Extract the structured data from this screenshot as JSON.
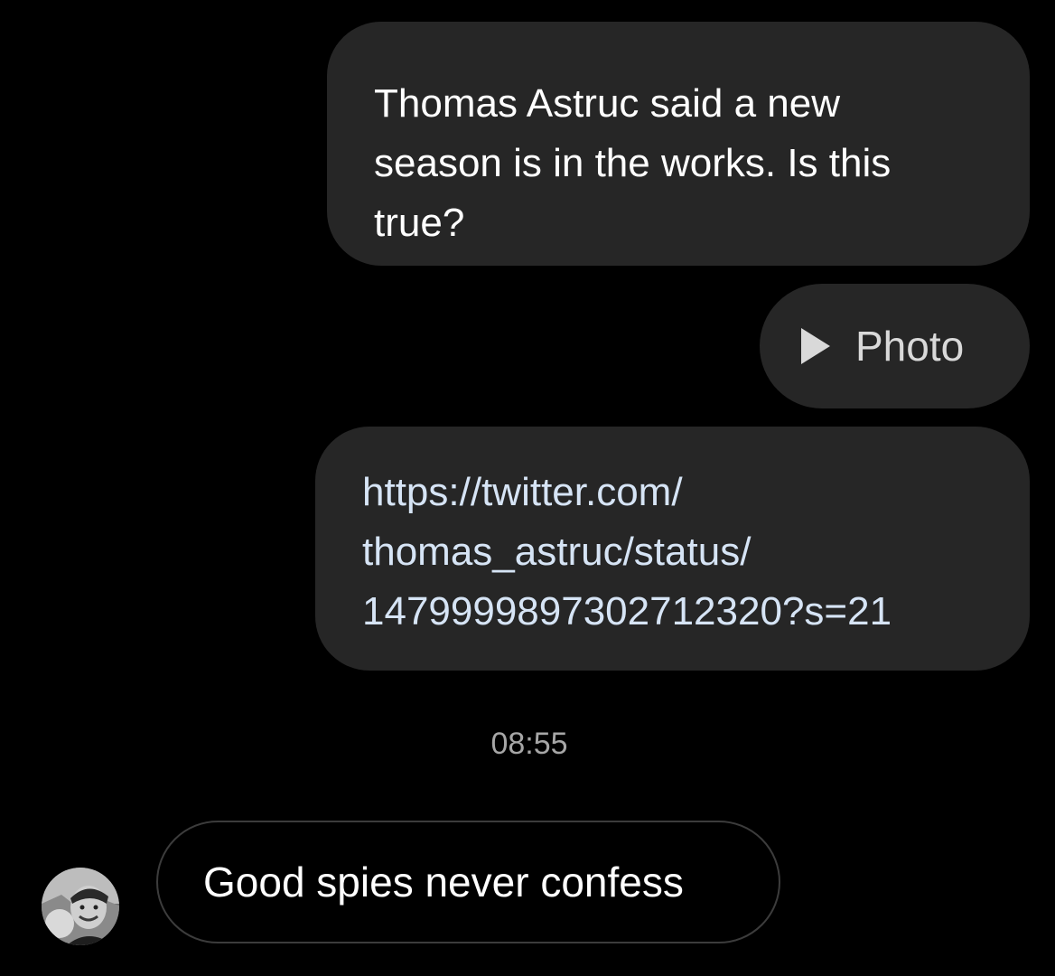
{
  "conversation": {
    "messages_sent": [
      {
        "lines": [
          "Thomas Astruc said a new",
          "season is in the works. Is this",
          "true?"
        ]
      },
      {
        "icon": "play-icon",
        "label": "Photo"
      },
      {
        "lines": [
          "https://twitter.com/",
          "thomas_astruc/status/",
          "1479999897302712320?s=21"
        ]
      }
    ],
    "timestamp": "08:55",
    "message_received": {
      "text": "Good spies never confess",
      "avatar_icon": "profile-avatar"
    }
  },
  "colors": {
    "background": "#000000",
    "sent_bubble": "#262626",
    "link_text": "#d6e4f5",
    "timestamp_text": "#a6a6a6",
    "received_border": "#3c3c3c"
  }
}
